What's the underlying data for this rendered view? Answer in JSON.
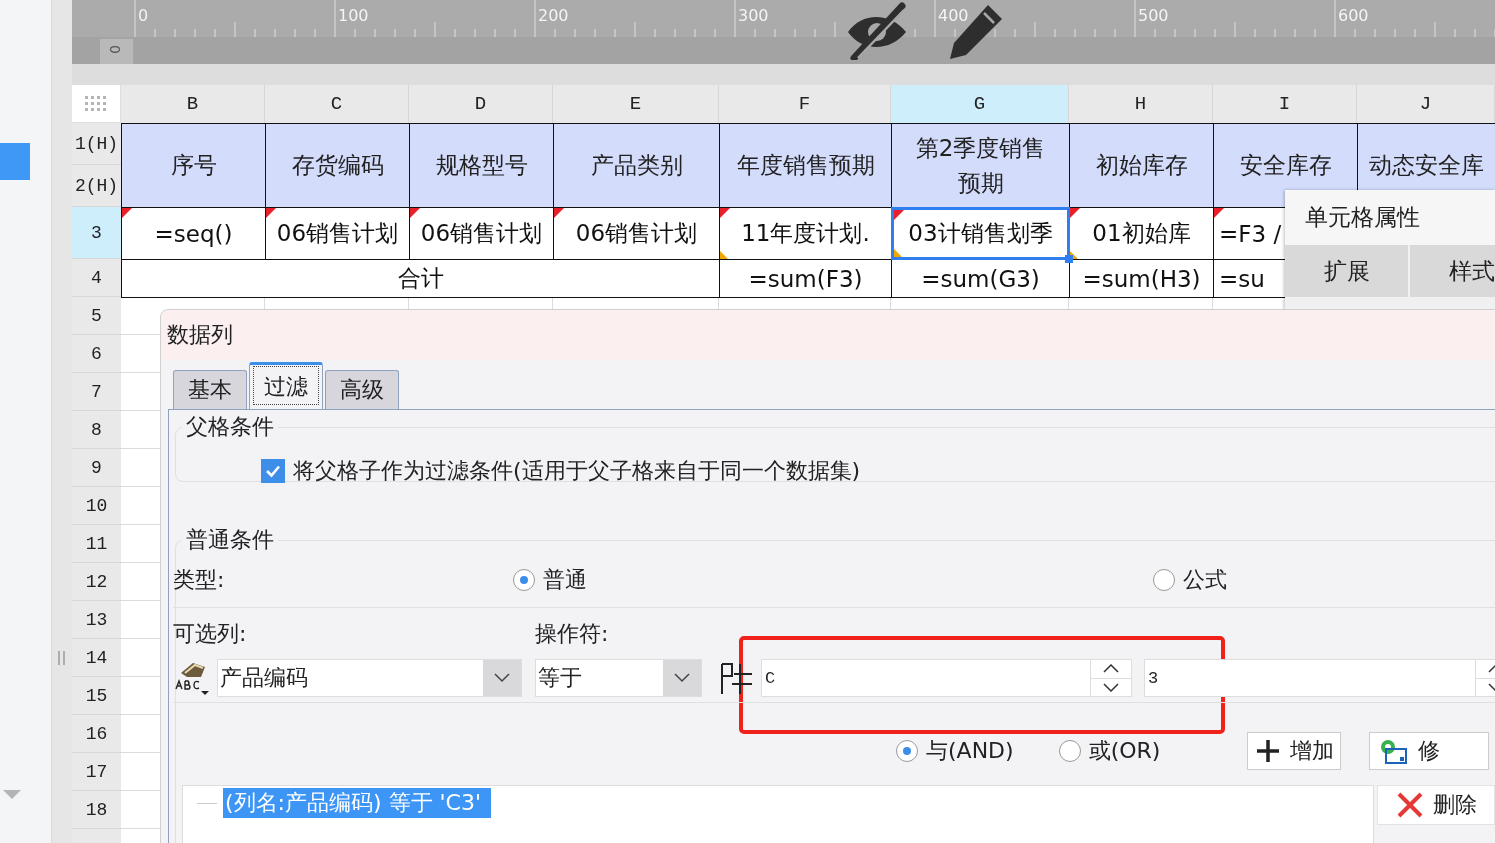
{
  "ruler": {
    "labels": [
      "0",
      "100",
      "200",
      "300",
      "400",
      "500",
      "600"
    ],
    "side_label": "0"
  },
  "sheet": {
    "columns": [
      {
        "label": "B",
        "selected": false
      },
      {
        "label": "C",
        "selected": false
      },
      {
        "label": "D",
        "selected": false
      },
      {
        "label": "E",
        "selected": false
      },
      {
        "label": "F",
        "selected": false
      },
      {
        "label": "G",
        "selected": true
      },
      {
        "label": "H",
        "selected": false
      },
      {
        "label": "I",
        "selected": false
      },
      {
        "label": "J",
        "selected": false
      }
    ],
    "rows": [
      {
        "label": "1(H)",
        "selected": false
      },
      {
        "label": "2(H)",
        "selected": false
      },
      {
        "label": "3",
        "selected": true
      },
      {
        "label": "4",
        "selected": false
      },
      {
        "label": "5",
        "selected": false
      },
      {
        "label": "6",
        "selected": false
      },
      {
        "label": "7",
        "selected": false
      },
      {
        "label": "8",
        "selected": false
      },
      {
        "label": "9",
        "selected": false
      },
      {
        "label": "10",
        "selected": false
      },
      {
        "label": "11",
        "selected": false
      },
      {
        "label": "12",
        "selected": false
      },
      {
        "label": "13",
        "selected": false
      },
      {
        "label": "14",
        "selected": false
      },
      {
        "label": "15",
        "selected": false
      },
      {
        "label": "16",
        "selected": false
      },
      {
        "label": "17",
        "selected": false
      },
      {
        "label": "18",
        "selected": false
      }
    ],
    "header_cells": [
      "序号",
      "存货编码",
      "规格型号",
      "产品类别",
      "年度销售预期",
      "第2季度销售预期",
      "初始库存",
      "安全库存",
      "动态安全库"
    ],
    "data_cells": [
      {
        "text": "=seq()",
        "selected": false,
        "flagged": true,
        "linked": false
      },
      {
        "text": "06销售计划",
        "selected": false,
        "flagged": true,
        "linked": false
      },
      {
        "text": "06销售计划",
        "selected": false,
        "flagged": true,
        "linked": false
      },
      {
        "text": "06销售计划",
        "selected": false,
        "flagged": true,
        "linked": false
      },
      {
        "text": "11年度计划.",
        "selected": false,
        "flagged": true,
        "linked": true
      },
      {
        "text": "03计销售划季",
        "selected": true,
        "flagged": true,
        "linked": true
      },
      {
        "text": "01初始库",
        "selected": false,
        "flagged": true,
        "linked": true
      },
      {
        "text": "=F3 /",
        "selected": false,
        "flagged": true,
        "linked": false
      }
    ],
    "total_label": "合计",
    "total_cells": [
      "=sum(F3)",
      "=sum(G3)",
      "=sum(H3)",
      "=su"
    ]
  },
  "cell_properties": {
    "title": "单元格属性",
    "tabs": [
      "扩展",
      "样式"
    ]
  },
  "dialog": {
    "title": "数据列",
    "tabs": [
      {
        "label": "基本",
        "selected": false
      },
      {
        "label": "过滤",
        "selected": true
      },
      {
        "label": "高级",
        "selected": false
      }
    ],
    "parent_condition": {
      "title": "父格条件",
      "label": "将父格子作为过滤条件(适用于父子格来自于同一个数据集)",
      "checked": true
    },
    "normal_condition": {
      "title": "普通条件",
      "type_label": "类型:",
      "type_options": [
        {
          "label": "普通",
          "selected": true
        },
        {
          "label": "公式",
          "selected": false
        }
      ],
      "column_label": "可选列:",
      "column_value": "产品编码",
      "operator_label": "操作符:",
      "operator_value": "等于",
      "value_fields": [
        "C",
        "3"
      ],
      "logic_options": [
        {
          "label": "与(AND)",
          "selected": true
        },
        {
          "label": "或(OR)",
          "selected": false
        }
      ],
      "buttons": [
        {
          "kind": "add",
          "label": "增加"
        },
        {
          "kind": "modify",
          "label": "修"
        }
      ],
      "conditions": [
        {
          "text": "(列名:产品编码) 等于 'C3'",
          "selected": true
        }
      ],
      "delete_button": "删除"
    }
  }
}
